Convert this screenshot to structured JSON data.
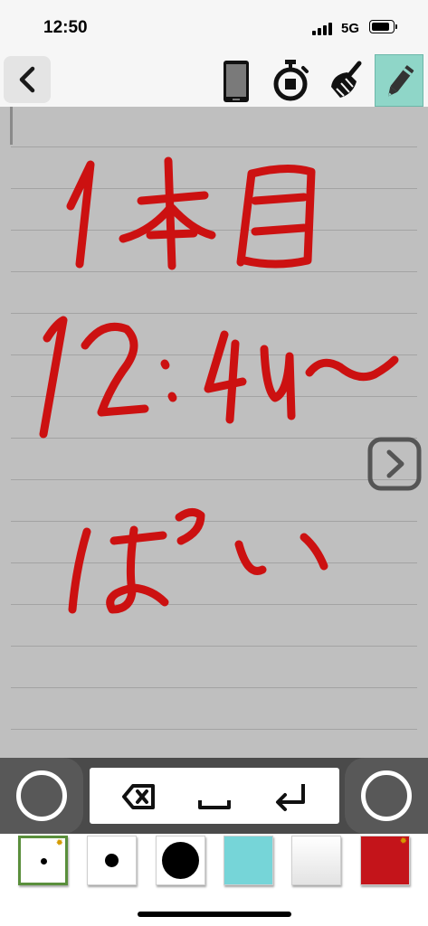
{
  "status_bar": {
    "time": "12:50",
    "network": "5G"
  },
  "toolbar": {
    "back_icon": "chevron-left-icon",
    "tools": [
      "phone-icon",
      "stopwatch-icon",
      "broom-icon",
      "pencil-icon"
    ],
    "active_tool": "pencil-icon"
  },
  "note": {
    "handwritten_lines": [
      "1本目",
      "12:40〜",
      "ぽい"
    ],
    "ink_color": "#cc1111"
  },
  "keys": [
    "backspace-icon",
    "space-icon",
    "return-icon"
  ],
  "palette": {
    "swatches": [
      "small-pen",
      "medium-pen",
      "large-pen",
      "cyan",
      "white",
      "red"
    ],
    "colors": {
      "cyan": "#76d5d8",
      "white": "#efefef",
      "red": "#c4141a"
    },
    "selected": "small-pen"
  }
}
